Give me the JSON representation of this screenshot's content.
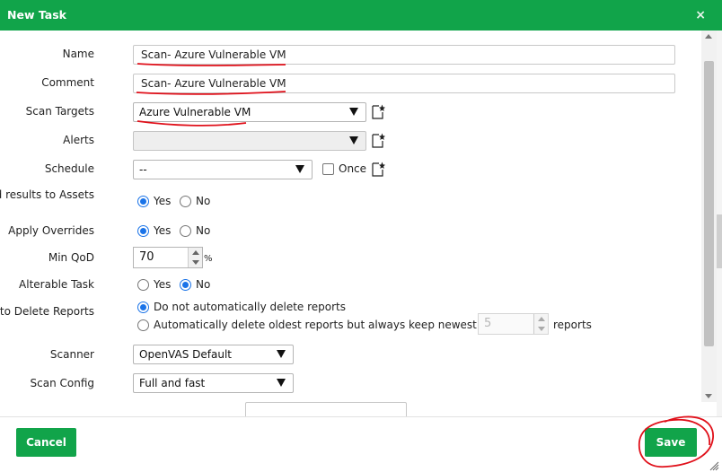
{
  "dialog": {
    "title": "New Task",
    "close_glyph": "×"
  },
  "form": {
    "name": {
      "label": "Name",
      "value": "Scan- Azure Vulnerable VM"
    },
    "comment": {
      "label": "Comment",
      "value": "Scan- Azure Vulnerable VM"
    },
    "scan_targets": {
      "label": "Scan Targets",
      "value": "Azure Vulnerable VM"
    },
    "alerts": {
      "label": "Alerts",
      "value": ""
    },
    "schedule": {
      "label": "Schedule",
      "value": "--",
      "once_label": "Once",
      "once_checked": false
    },
    "add_results": {
      "label": "Add results to Assets",
      "yes": "Yes",
      "no": "No",
      "selected": "Yes"
    },
    "apply_overrides": {
      "label": "Apply Overrides",
      "yes": "Yes",
      "no": "No",
      "selected": "Yes"
    },
    "min_qod": {
      "label": "Min QoD",
      "value": "70",
      "unit": "%"
    },
    "alterable_task": {
      "label": "Alterable Task",
      "yes": "Yes",
      "no": "No",
      "selected": "No"
    },
    "auto_delete": {
      "label": "Auto Delete Reports",
      "option_no": "Do not automatically delete reports",
      "option_yes": "Automatically delete oldest reports but always keep newest",
      "keep_value": "5",
      "keep_unit": "reports",
      "selected": "option_no"
    },
    "scanner": {
      "label": "Scanner",
      "value": "OpenVAS Default"
    },
    "scan_config": {
      "label": "Scan Config",
      "value": "Full and fast"
    }
  },
  "footer": {
    "cancel_label": "Cancel",
    "save_label": "Save"
  },
  "colors": {
    "accent": "#11a44a",
    "radio_selected": "#1a73e8",
    "annotation": "#e0101a"
  },
  "icons": {
    "new_item": "new-item-star-icon",
    "close": "close-icon"
  }
}
